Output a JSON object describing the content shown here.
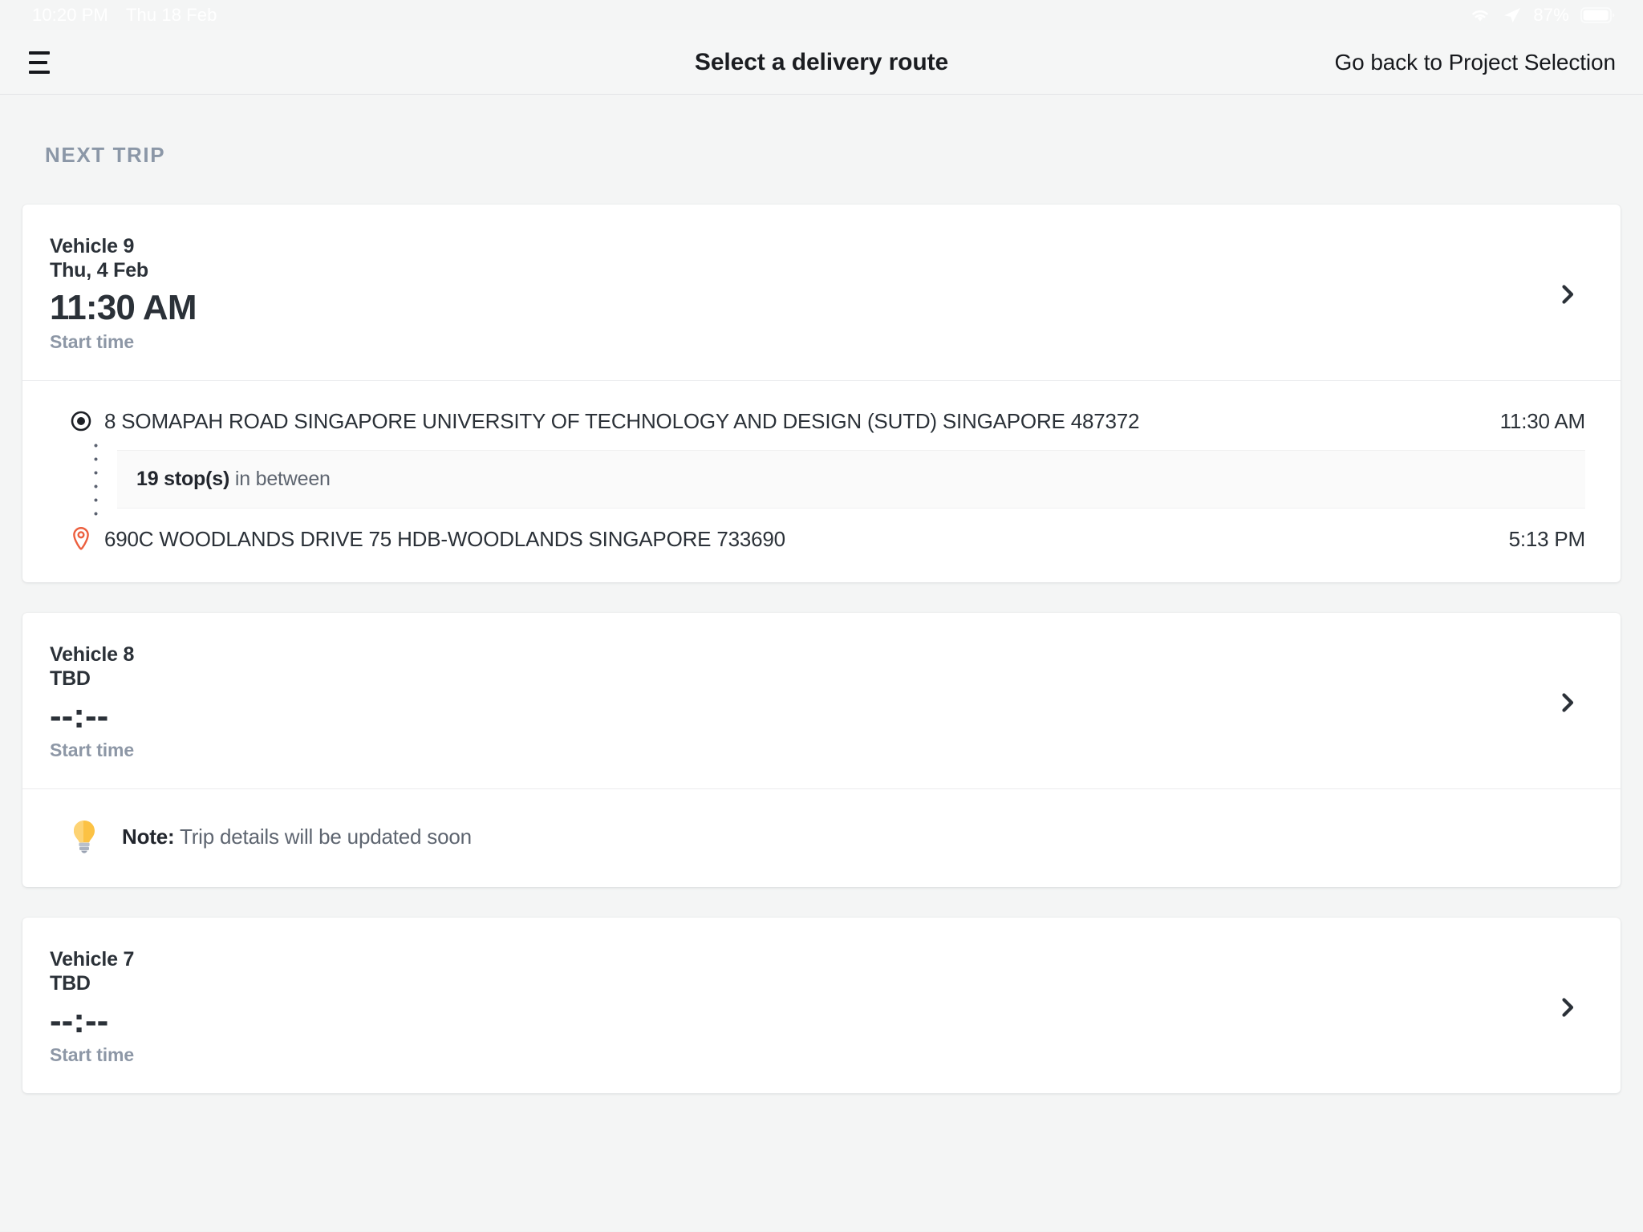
{
  "status_bar": {
    "time": "10:20 PM",
    "date": "Thu 18 Feb",
    "battery_percent": "87%",
    "icons": [
      "wifi-icon",
      "location-arrow-icon",
      "battery-icon"
    ]
  },
  "header": {
    "menu_icon": "hamburger-menu-icon",
    "title": "Select a delivery route",
    "action_label": "Go back to Project Selection"
  },
  "main": {
    "section_label": "NEXT TRIP",
    "trips": [
      {
        "vehicle": "Vehicle 9",
        "date": "Thu, 4 Feb",
        "time": "11:30 AM",
        "time_caption": "Start time",
        "chevron_icon": "chevron-right-icon",
        "route": {
          "origin": {
            "marker_icon": "origin-dot-icon",
            "address": "8 SOMAPAH ROAD SINGAPORE UNIVERSITY OF TECHNOLOGY AND DESIGN (SUTD) SINGAPORE 487372",
            "time": "11:30 AM"
          },
          "between_count": "19 stop(s)",
          "between_suffix": " in between",
          "destination": {
            "marker_icon": "map-pin-icon",
            "address": "690C WOODLANDS DRIVE 75 HDB-WOODLANDS SINGAPORE 733690",
            "time": "5:13 PM"
          }
        }
      },
      {
        "vehicle": "Vehicle 8",
        "date": "TBD",
        "time": "--:--",
        "time_caption": "Start time",
        "chevron_icon": "chevron-right-icon",
        "note": {
          "icon": "lightbulb-icon",
          "label": "Note:",
          "text": " Trip details will be updated soon"
        }
      },
      {
        "vehicle": "Vehicle 7",
        "date": "TBD",
        "time": "--:--",
        "time_caption": "Start time",
        "chevron_icon": "chevron-right-icon"
      }
    ]
  },
  "colors": {
    "page_bg": "#f4f5f5",
    "card_bg": "#ffffff",
    "text_primary": "#2b3138",
    "text_muted": "#8d97a6",
    "accent_pin": "#ec5f3e",
    "divider": "#ebecee"
  }
}
